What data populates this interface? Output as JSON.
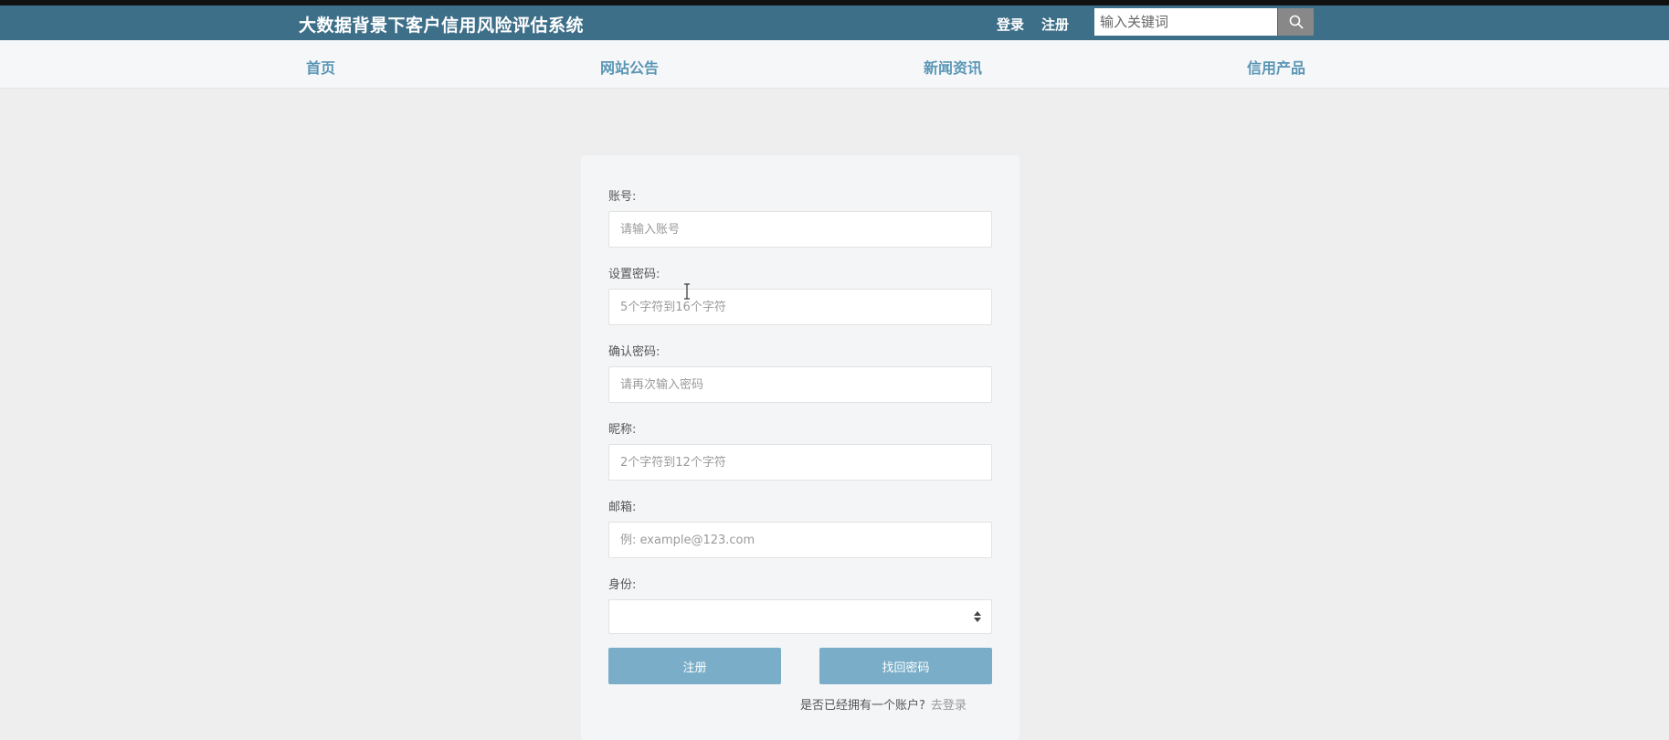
{
  "header": {
    "title": "大数据背景下客户信用风险评估系统",
    "login": "登录",
    "register": "注册",
    "search_placeholder": "输入关键词",
    "search_icon": "search-icon"
  },
  "nav": {
    "items": [
      {
        "label": "首页"
      },
      {
        "label": "网站公告"
      },
      {
        "label": "新闻资讯"
      },
      {
        "label": "信用产品"
      }
    ]
  },
  "form": {
    "account_label": "账号:",
    "account_placeholder": "请输入账号",
    "password_label": "设置密码:",
    "password_placeholder": "5个字符到16个字符",
    "confirm_label": "确认密码:",
    "confirm_placeholder": "请再次输入密码",
    "nickname_label": "昵称:",
    "nickname_placeholder": "2个字符到12个字符",
    "email_label": "邮箱:",
    "email_placeholder": "例: example@123.com",
    "identity_label": "身份:",
    "identity_value": "",
    "register_button": "注册",
    "recover_button": "找回密码",
    "login_hint": "是否已经拥有一个账户?",
    "login_link": "去登录"
  },
  "colors": {
    "header_bg": "#3e6f89",
    "nav_text": "#5a96b5",
    "button_bg": "#7aaec8"
  }
}
